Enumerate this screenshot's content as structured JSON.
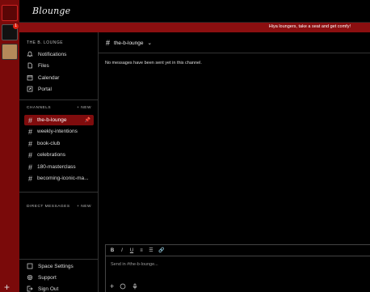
{
  "header": {
    "logo_text": "Blounge"
  },
  "banner": {
    "text": "Hiya loungers, take a seat and get comfy!"
  },
  "rail": {
    "badge_count": "1"
  },
  "sidebar": {
    "org_name": "THE B. LOUNGE",
    "nav": [
      {
        "label": "Notifications",
        "icon": "bell-icon"
      },
      {
        "label": "Files",
        "icon": "file-icon"
      },
      {
        "label": "Calendar",
        "icon": "calendar-icon"
      },
      {
        "label": "Portal",
        "icon": "portal-icon"
      }
    ],
    "channels_heading": "CHANNELS",
    "channels_new": "+ NEW",
    "channels": [
      {
        "name": "the-b-lounge",
        "active": true,
        "pinned": true
      },
      {
        "name": "weekly-intentions"
      },
      {
        "name": "book-club"
      },
      {
        "name": "celebrations"
      },
      {
        "name": "180-masterclass"
      },
      {
        "name": "becoming-iconic-ma..."
      }
    ],
    "dm_heading": "DIRECT MESSAGES",
    "dm_new": "+ NEW",
    "footer": [
      {
        "label": "Space Settings",
        "icon": "settings-icon"
      },
      {
        "label": "Support",
        "icon": "support-icon"
      },
      {
        "label": "Sign Out",
        "icon": "sign-out-icon"
      }
    ]
  },
  "main": {
    "channel_name": "the-b-lounge",
    "empty_message": "No messages have been sent yet in this channel.",
    "composer": {
      "placeholder": "Send in #the-b-lounge...",
      "format_buttons": [
        "B",
        "I",
        "U",
        "≡",
        "☰",
        "🔗"
      ]
    }
  },
  "colors": {
    "accent": "#7f0c0d",
    "banner": "#8b0f10",
    "background": "#000000"
  }
}
